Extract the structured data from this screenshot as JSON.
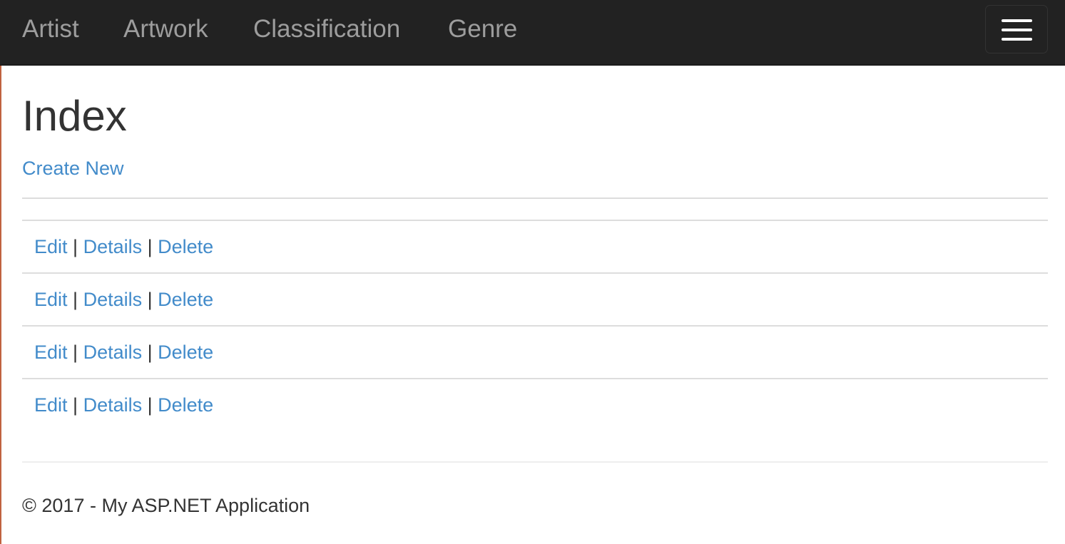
{
  "navbar": {
    "links": [
      {
        "label": "Artist"
      },
      {
        "label": "Artwork"
      },
      {
        "label": "Classification"
      },
      {
        "label": "Genre"
      }
    ],
    "toggle_icon": "hamburger-menu-icon"
  },
  "page": {
    "title": "Index",
    "create_link": "Create New"
  },
  "table": {
    "rows": [
      {
        "edit": "Edit",
        "separator1": "|",
        "details": "Details",
        "separator2": "|",
        "delete": "Delete"
      },
      {
        "edit": "Edit",
        "separator1": "|",
        "details": "Details",
        "separator2": "|",
        "delete": "Delete"
      },
      {
        "edit": "Edit",
        "separator1": "|",
        "details": "Details",
        "separator2": "|",
        "delete": "Delete"
      },
      {
        "edit": "Edit",
        "separator1": "|",
        "details": "Details",
        "separator2": "|",
        "delete": "Delete"
      }
    ]
  },
  "footer": {
    "text": "© 2017 - My ASP.NET Application"
  },
  "colors": {
    "navbar_bg": "#222222",
    "nav_link": "#9d9d9d",
    "link": "#428bca",
    "text": "#333333"
  }
}
